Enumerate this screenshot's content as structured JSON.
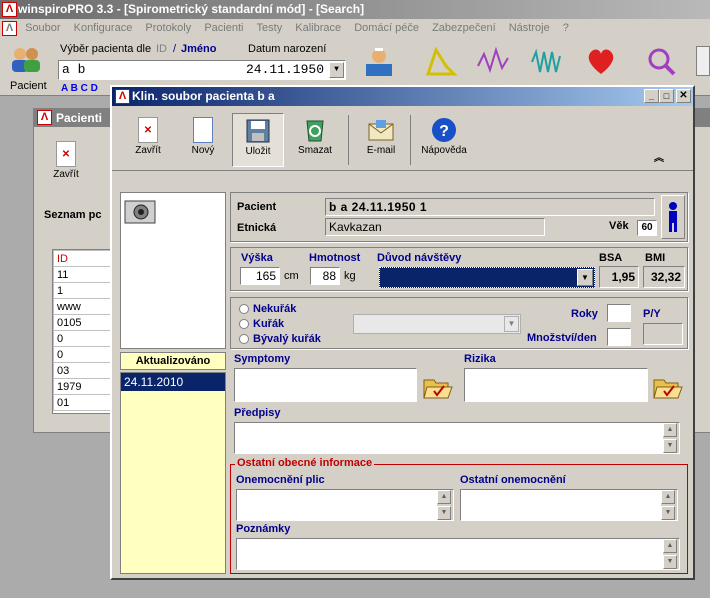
{
  "app": {
    "title": "winspiroPRO 3.3 - [Spirometrický standardní mód] - [Search]"
  },
  "menu": [
    "Soubor",
    "Konfigurace",
    "Protokoly",
    "Pacienti",
    "Testy",
    "Kalibrace",
    "Domácí péče",
    "Zabezpečení",
    "Nástroje",
    "?"
  ],
  "main_toolbar": {
    "patient_label": "Pacient",
    "select_label": "Výběr pacienta dle",
    "id_label": "ID",
    "slash": "/",
    "name_label": "Jméno",
    "dob_label": "Datum narození",
    "search_value": "a b",
    "dob_value": "24.11.1950",
    "alphabet": "A B C D"
  },
  "bg_window": {
    "title": "Pacienti",
    "close_label": "Zavřít",
    "list_label": "Seznam pc",
    "column_id": "ID",
    "ids": [
      "11",
      "1",
      "www",
      "0105",
      "0",
      "0",
      "03",
      "1979",
      "01"
    ]
  },
  "dialog": {
    "title": "Klin. soubor pacienta b a",
    "toolbar": {
      "close": "Zavřít",
      "new": "Nový",
      "save": "Uložit",
      "delete": "Smazat",
      "email": "E-mail",
      "help": "Nápověda"
    },
    "updated_label": "Aktualizováno",
    "dates": [
      "24.11.2010"
    ],
    "patient_label": "Pacient",
    "patient_value": "b a   24.11.1950   1",
    "ethnic_label": "Etnická",
    "ethnic_value": "Kavkazan",
    "age_label": "Věk",
    "age_value": "60",
    "height_label": "Výška",
    "height_value": "165",
    "height_unit": "cm",
    "weight_label": "Hmotnost",
    "weight_value": "88",
    "weight_unit": "kg",
    "reason_label": "Důvod návštěvy",
    "bsa_label": "BSA",
    "bsa_value": "1,95",
    "bmi_label": "BMI",
    "bmi_value": "32,32",
    "smoking": [
      "Nekuřák",
      "Kuřák",
      "Bývalý kuřák"
    ],
    "years_label": "Roky",
    "py_label": "P/Y",
    "amount_label": "Množství/den",
    "symptoms_label": "Symptomy",
    "risks_label": "Rizika",
    "prescriptions_label": "Předpisy",
    "other_info_label": "Ostatní obecné informace",
    "lung_label": "Onemocnění plic",
    "other_disease_label": "Ostatní onemocnění",
    "notes_label": "Poznámky"
  },
  "colors": {
    "title_active": "#0a246a",
    "title_inactive": "#808080",
    "selection": "#0a246a",
    "date_bg": "#ffffc0"
  }
}
